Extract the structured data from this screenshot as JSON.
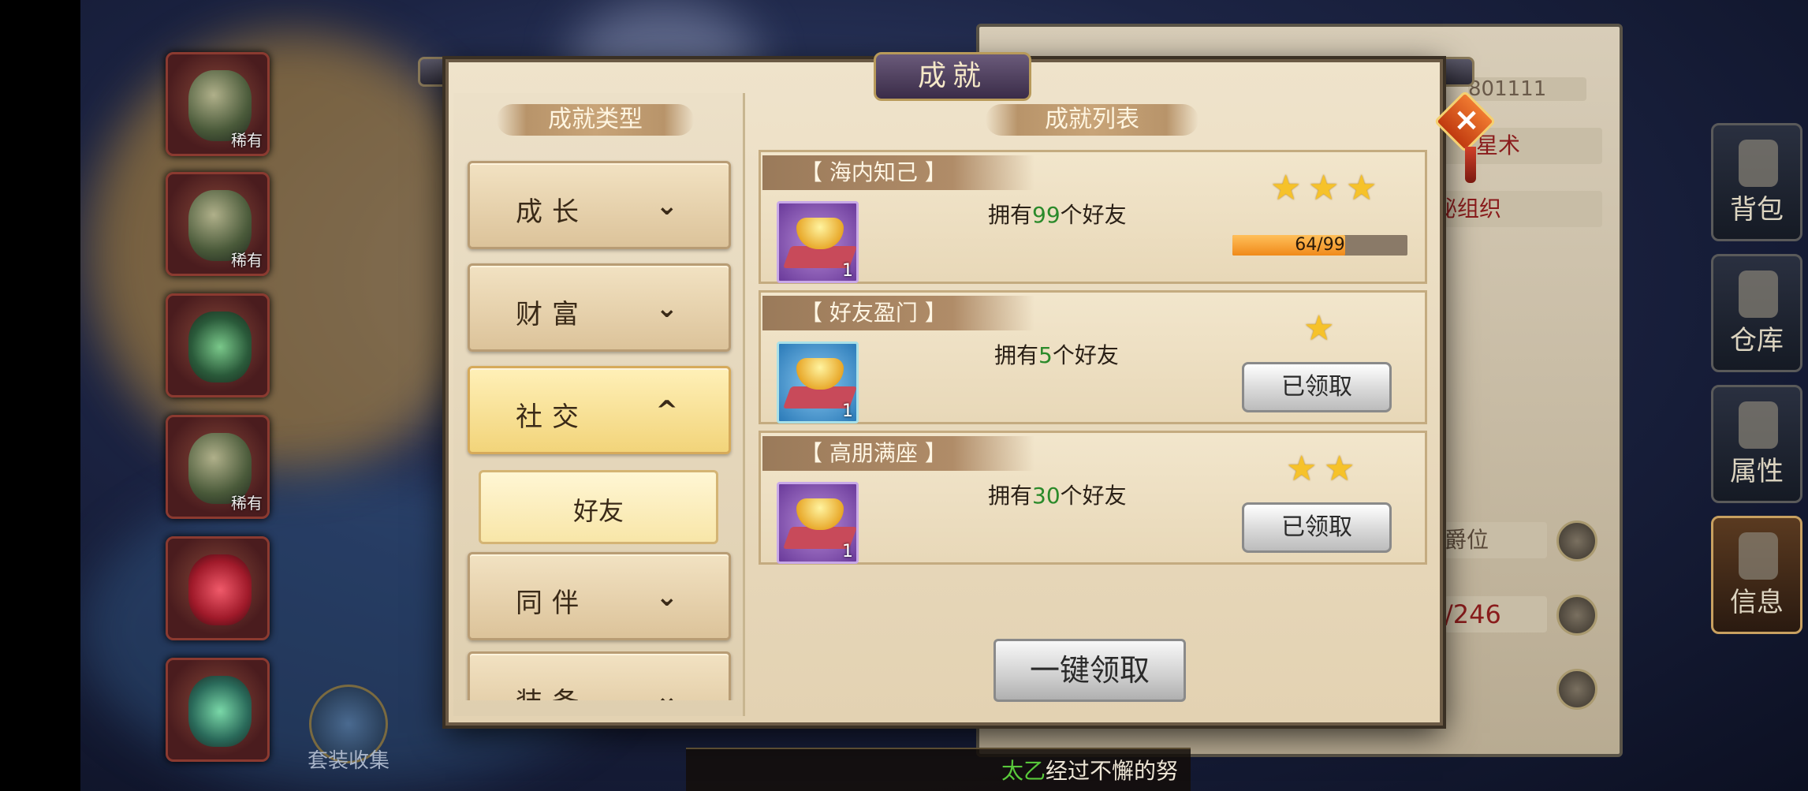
{
  "modal": {
    "title": "成就",
    "close_icon": "×"
  },
  "category_panel": {
    "header": "成就类型",
    "categories": [
      {
        "label": "成长",
        "expanded": false,
        "chevron": "⌄"
      },
      {
        "label": "财富",
        "expanded": false,
        "chevron": "⌄"
      },
      {
        "label": "社交",
        "expanded": true,
        "chevron": "^"
      },
      {
        "label": "同伴",
        "expanded": false,
        "chevron": "⌄"
      },
      {
        "label": "装备",
        "expanded": false,
        "chevron": "⌄"
      }
    ],
    "subcategory": {
      "label": "好友"
    }
  },
  "achievement_panel": {
    "header": "成就列表",
    "items": [
      {
        "title": "【 海内知己 】",
        "desc_prefix": "拥有",
        "desc_num": "99",
        "desc_suffix": "个好友",
        "stars": 3,
        "reward_count": "1",
        "progress_text": "64/99",
        "progress": 0.646,
        "status": "in_progress"
      },
      {
        "title": "【 好友盈门 】",
        "desc_prefix": "拥有",
        "desc_num": "5",
        "desc_suffix": "个好友",
        "stars": 1,
        "reward_count": "1",
        "button": "已领取",
        "status": "claimed"
      },
      {
        "title": "【 高朋满座 】",
        "desc_prefix": "拥有",
        "desc_num": "30",
        "desc_suffix": "个好友",
        "stars": 2,
        "reward_count": "1",
        "button": "已领取",
        "status": "claimed"
      }
    ],
    "claim_all": "一键领取"
  },
  "left_equipment": {
    "tags": [
      "稀有",
      "稀有",
      "稀有"
    ],
    "suit_label": "套装收集"
  },
  "right_panel": {
    "id_text": "801111",
    "field_1": "星术",
    "field_2": "神秘组织",
    "field_3": "爵位",
    "field_4": "/246"
  },
  "side_menu": [
    {
      "label": "背包"
    },
    {
      "label": "仓库"
    },
    {
      "label": "属性"
    },
    {
      "label": "信息"
    }
  ],
  "chat": {
    "name": "太乙",
    "text": "经过不懈的努"
  },
  "colors": {
    "accent_green": "#2a8a2a",
    "star_gold": "#f6c22a",
    "progress_orange": "#f08a1a"
  }
}
